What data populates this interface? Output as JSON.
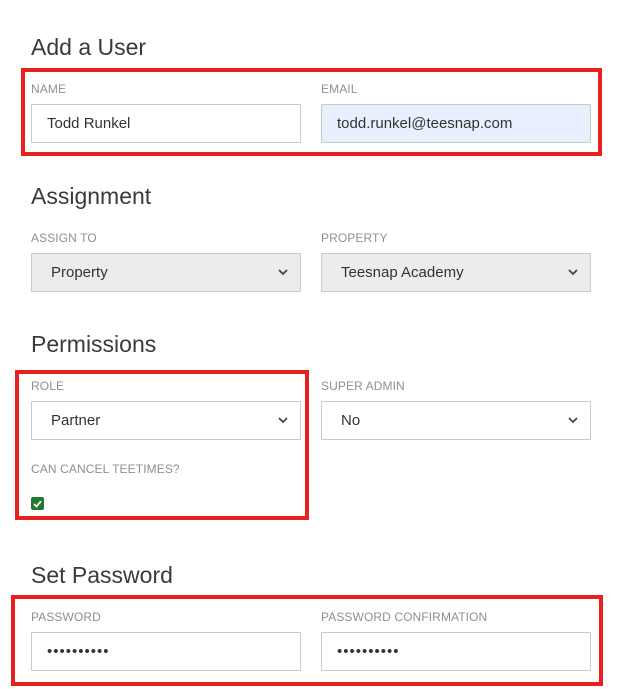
{
  "add_user": {
    "title": "Add a User",
    "name_label": "NAME",
    "name_value": "Todd Runkel",
    "email_label": "EMAIL",
    "email_value": "todd.runkel@teesnap.com"
  },
  "assignment": {
    "title": "Assignment",
    "assign_to_label": "ASSIGN TO",
    "assign_to_value": "Property",
    "property_label": "PROPERTY",
    "property_value": "Teesnap Academy"
  },
  "permissions": {
    "title": "Permissions",
    "role_label": "ROLE",
    "role_value": "Partner",
    "super_admin_label": "SUPER ADMIN",
    "super_admin_value": "No",
    "cancel_teetimes_label": "CAN CANCEL TEETIMES?",
    "cancel_teetimes_checked": true
  },
  "password": {
    "title": "Set Password",
    "password_label": "PASSWORD",
    "password_value": "••••••••••",
    "confirmation_label": "PASSWORD CONFIRMATION",
    "confirmation_value": "••••••••••"
  },
  "colors": {
    "highlight": "#e8211f",
    "checkbox": "#1e7a2e",
    "autofill": "#e8f0fe"
  }
}
